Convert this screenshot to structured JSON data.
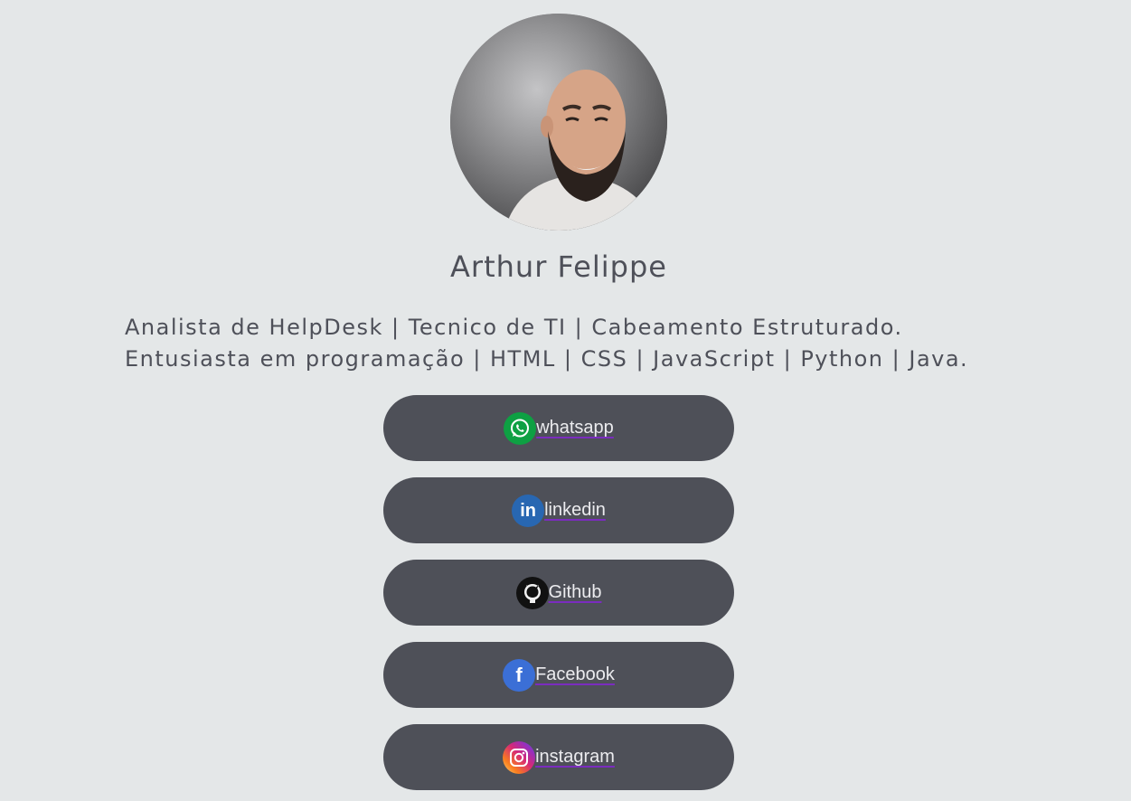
{
  "profile": {
    "name": "Arthur Felippe",
    "bio_line_1": "Analista de HelpDesk | Tecnico de TI | Cabeamento Estruturado.",
    "bio_line_2": "Entusiasta em programação | HTML | CSS | JavaScript | Python | Java."
  },
  "links": [
    {
      "label": "whatsapp",
      "icon": "whatsapp-icon",
      "color": "#0ea043"
    },
    {
      "label": "linkedin",
      "icon": "linkedin-icon",
      "color": "#2867b2"
    },
    {
      "label": "Github",
      "icon": "github-icon",
      "color": "#111111"
    },
    {
      "label": "Facebook",
      "icon": "facebook-icon",
      "color": "#3b6fd6"
    },
    {
      "label": "instagram",
      "icon": "instagram-icon",
      "color": "#e1306c"
    }
  ],
  "colors": {
    "background": "#e4e7e8",
    "button": "#4e5058",
    "text": "#4e5059",
    "link_underline": "#7b2cbf"
  }
}
